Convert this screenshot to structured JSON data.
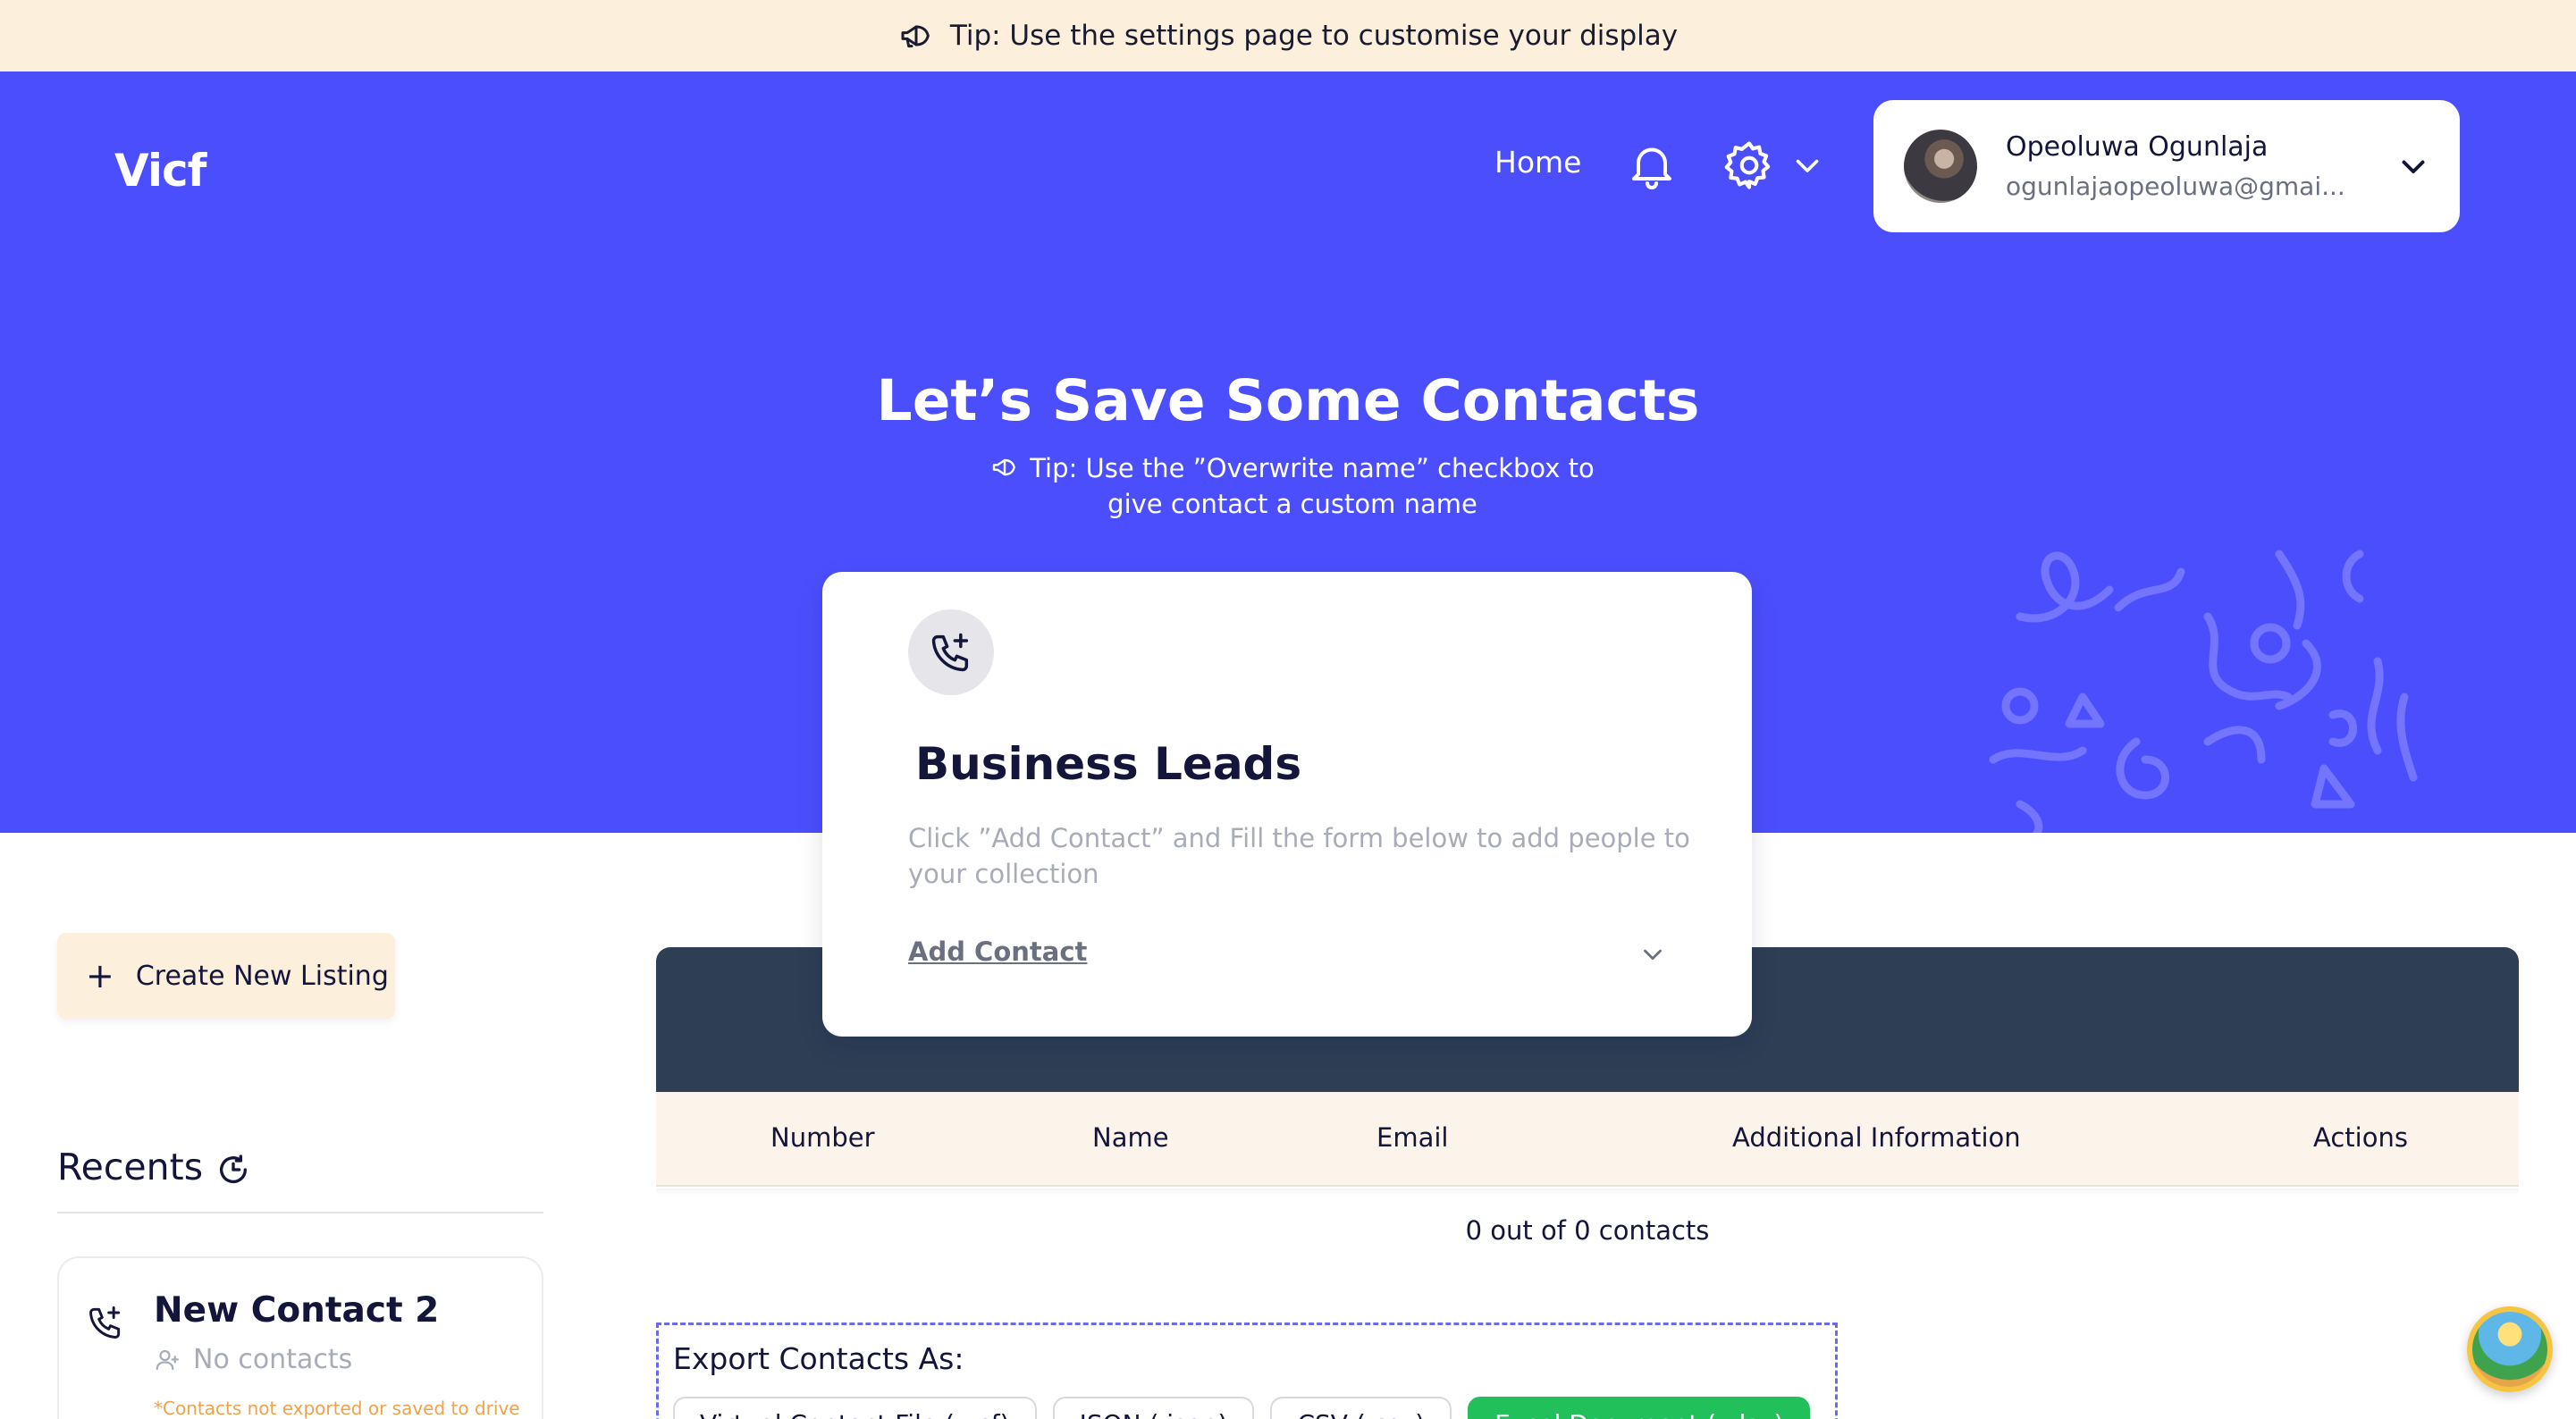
{
  "tip_banner": {
    "text": "Tip: Use the settings page to customise your display",
    "icon": "megaphone-icon"
  },
  "header": {
    "logo": "Vicf",
    "nav_home": "Home",
    "icons": [
      "bell-icon",
      "gear-icon",
      "chevron-down-icon"
    ],
    "user": {
      "name": "Opeoluwa Ogunlaja",
      "email": "ogunlajaopeoluwa@gmai..."
    }
  },
  "hero": {
    "title": "Let’s Save Some Contacts",
    "tip": "Tip: Use the ”Overwrite name” checkbox to give contact a custom name"
  },
  "card": {
    "title": "Business Leads",
    "description": "Click ”Add Contact” and Fill the form below to add people to your collection",
    "add_contact_label": "Add Contact"
  },
  "sidebar": {
    "create_label": "Create New Listing",
    "recents_label": "Recents",
    "recent_items": [
      {
        "title": "New Contact 2",
        "subtitle": "No contacts",
        "note": "*Contacts not exported or saved to drive"
      }
    ]
  },
  "table": {
    "columns": [
      "Number",
      "Name",
      "Email",
      "Additional Information",
      "Actions"
    ],
    "count_text": "0 out of 0 contacts"
  },
  "export": {
    "title": "Export Contacts As:",
    "buttons": [
      "Virtual Contact File (.vcf)",
      "JSON (.json)",
      "CSV (.csv)",
      "Excel Document (.xlsx)"
    ]
  },
  "colors": {
    "brand": "#4b4efc",
    "banner": "#fcefdc",
    "table_top": "#2d3e55",
    "accent_green": "#22c05a"
  }
}
